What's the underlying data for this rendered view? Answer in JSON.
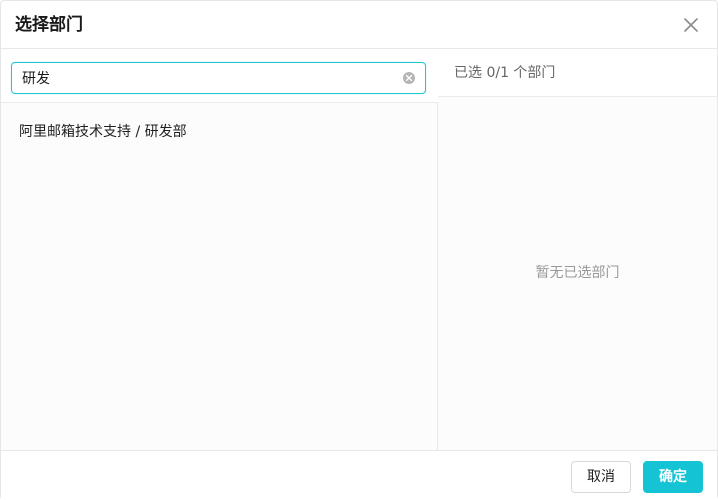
{
  "dialog": {
    "title": "选择部门"
  },
  "search": {
    "value": "研发",
    "placeholder": ""
  },
  "results": [
    {
      "label": "阿里邮箱技术支持 / 研发部"
    }
  ],
  "selected": {
    "count_text": "已选 0/1 个部门",
    "empty_text": "暂无已选部门"
  },
  "footer": {
    "cancel_label": "取消",
    "confirm_label": "确定"
  },
  "colors": {
    "accent": "#14c4d4",
    "border": "#e8e8e8"
  },
  "icons": {
    "close": "close-icon",
    "clear": "clear-icon"
  }
}
